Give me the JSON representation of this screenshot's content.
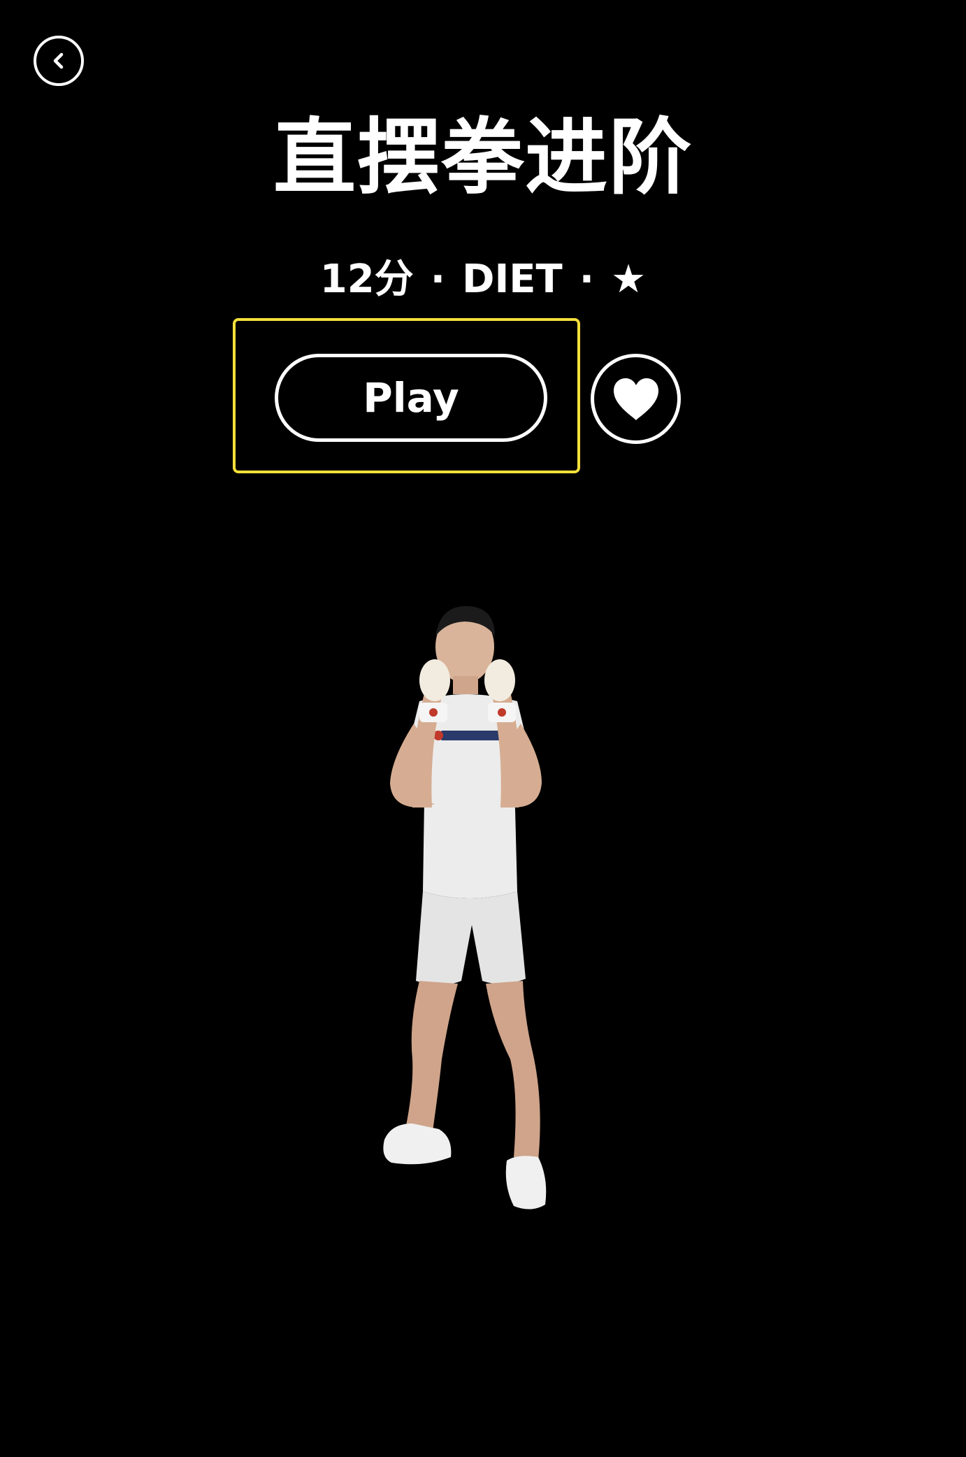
{
  "header": {
    "back_icon": "chevron-left-icon"
  },
  "workout": {
    "title": "直摆拳进阶",
    "duration": "12分",
    "separator": "·",
    "category": "DIET",
    "difficulty_stars": 1,
    "difficulty_symbol": "★"
  },
  "actions": {
    "play_label": "Play",
    "like_icon": "heart-icon",
    "focus_color": "#f4e03a"
  },
  "trainer": {
    "image": "trainer-figure"
  }
}
